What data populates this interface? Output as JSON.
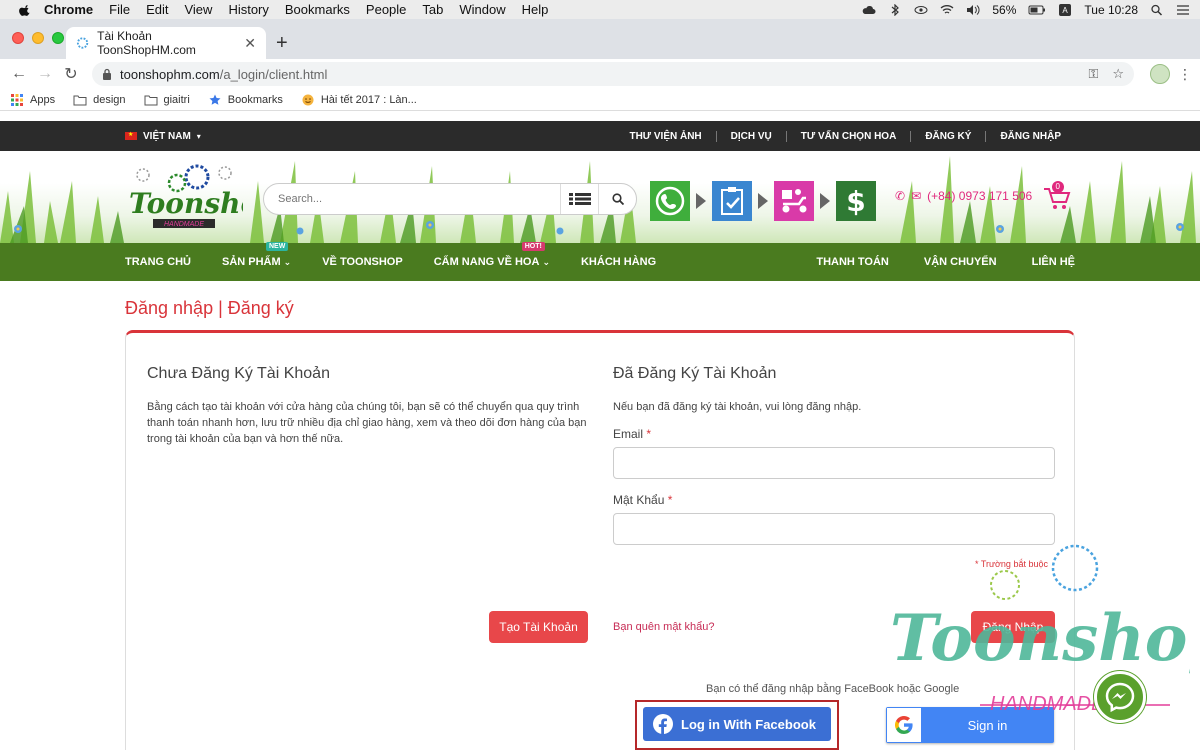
{
  "menubar": {
    "app": "Chrome",
    "items": [
      "File",
      "Edit",
      "View",
      "History",
      "Bookmarks",
      "People",
      "Tab",
      "Window",
      "Help"
    ],
    "battery": "56%",
    "clock": "Tue 10:28"
  },
  "browser": {
    "tab_title": "Tài Khoản ToonShopHM.com",
    "url_domain": "toonshophm.com",
    "url_path": "/a_login/client.html",
    "bookmarks": [
      "Apps",
      "design",
      "giaitri",
      "Bookmarks",
      "Hài tết 2017 : Làn..."
    ]
  },
  "site": {
    "language": "VIỆT NAM",
    "top_links": [
      "THƯ VIỆN ẢNH",
      "DỊCH VỤ",
      "TƯ VẤN CHỌN HOA",
      "ĐĂNG KÝ",
      "ĐĂNG NHẬP"
    ],
    "search_placeholder": "Search...",
    "hotline": "(+84) 0973 171 506",
    "cart_count": "0",
    "nav_left": [
      {
        "label": "TRANG CHỦ",
        "tag": "",
        "dropdown": false
      },
      {
        "label": "SẢN PHẨM",
        "tag": "NEW",
        "dropdown": true
      },
      {
        "label": "VỀ TOONSHOP",
        "tag": "",
        "dropdown": false
      },
      {
        "label": "CẨM NANG VỀ HOA",
        "tag": "HOT!",
        "dropdown": true
      },
      {
        "label": "KHÁCH HÀNG",
        "tag": "",
        "dropdown": false
      }
    ],
    "nav_right": [
      "THANH TOÁN",
      "VẬN CHUYỂN",
      "LIÊN HỆ"
    ],
    "colors": {
      "brand_green": "#4a7b1f",
      "accent_red": "#d9343a",
      "dark_bar": "#2b2b2b"
    }
  },
  "page": {
    "title": "Đăng nhập | Đăng ký",
    "register": {
      "heading": "Chưa Đăng Ký Tài Khoản",
      "description": "Bằng cách tạo tài khoản với cửa hàng của chúng tôi, bạn sẽ có thể chuyển qua quy trình thanh toán nhanh hơn, lưu trữ nhiều địa chỉ giao hàng, xem và theo dõi đơn hàng của bạn trong tài khoản của bạn và hơn thế nữa.",
      "button": "Tạo Tài Khoản"
    },
    "login": {
      "heading": "Đã Đăng Ký Tài Khoản",
      "description": "Nếu bạn đã đăng ký tài khoản, vui lòng đăng nhập.",
      "email_label": "Email",
      "password_label": "Mật Khẩu",
      "required_marker": "*",
      "required_note": "* Trường bắt buộc",
      "forgot": "Bạn quên mật khẩu?",
      "button": "Đăng Nhập"
    },
    "social": {
      "note": "Bạn có thể đăng nhập bằng FaceBook hoặc Google",
      "facebook": "Log in With Facebook",
      "google": "Sign in"
    }
  },
  "watermark": {
    "brand": "Toonshop",
    "sub": "HANDMADE"
  }
}
